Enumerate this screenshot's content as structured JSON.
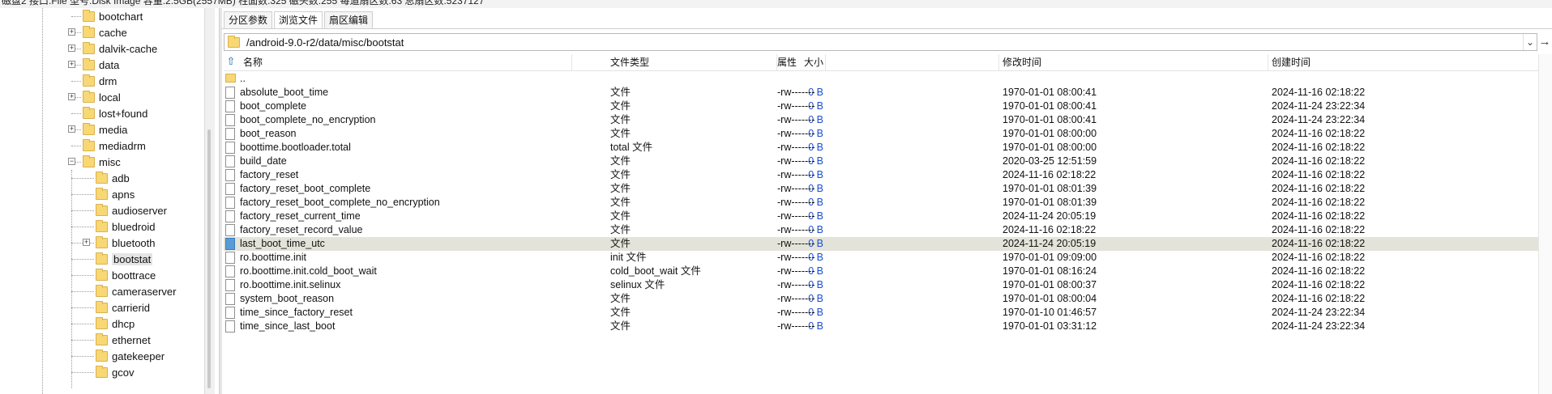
{
  "statusbar": {
    "text": "磁盘2 接口:File  型号:Disk Image  容量:2.5GB(2557MB)  柱面数:325  磁头数:255  每道扇区数:63  总扇区数:5237127"
  },
  "tree": {
    "items": [
      {
        "label": "bootchart",
        "expander": ""
      },
      {
        "label": "cache",
        "expander": "+"
      },
      {
        "label": "dalvik-cache",
        "expander": "+"
      },
      {
        "label": "data",
        "expander": "+"
      },
      {
        "label": "drm",
        "expander": ""
      },
      {
        "label": "local",
        "expander": "+"
      },
      {
        "label": "lost+found",
        "expander": ""
      },
      {
        "label": "media",
        "expander": "+"
      },
      {
        "label": "mediadrm",
        "expander": ""
      },
      {
        "label": "misc",
        "expander": "−"
      }
    ],
    "children": [
      {
        "label": "adb",
        "expander": ""
      },
      {
        "label": "apns",
        "expander": ""
      },
      {
        "label": "audioserver",
        "expander": ""
      },
      {
        "label": "bluedroid",
        "expander": ""
      },
      {
        "label": "bluetooth",
        "expander": "+"
      },
      {
        "label": "bootstat",
        "expander": "",
        "selected": true
      },
      {
        "label": "boottrace",
        "expander": ""
      },
      {
        "label": "cameraserver",
        "expander": ""
      },
      {
        "label": "carrierid",
        "expander": ""
      },
      {
        "label": "dhcp",
        "expander": ""
      },
      {
        "label": "ethernet",
        "expander": ""
      },
      {
        "label": "gatekeeper",
        "expander": ""
      },
      {
        "label": "gcov",
        "expander": ""
      }
    ]
  },
  "tabs": [
    {
      "label": "分区参数",
      "active": false
    },
    {
      "label": "浏览文件",
      "active": true
    },
    {
      "label": "扇区编辑",
      "active": false
    }
  ],
  "path": {
    "value": "/android-9.0-r2/data/misc/bootstat",
    "dropdown_icon": "chevron-down-icon",
    "go_icon": "arrow-right-icon",
    "go_label": "→"
  },
  "columns": {
    "up_label": "⇧",
    "name": "名称",
    "size": "大小",
    "type": "文件类型",
    "attr": "属性",
    "modified": "修改时间",
    "created": "创建时间"
  },
  "parent_row": "..",
  "files": [
    {
      "name": "absolute_boot_time",
      "size": "0 B",
      "type": "文件",
      "attr": "-rw-------",
      "modified": "1970-01-01 08:00:41",
      "created": "2024-11-16 02:18:22"
    },
    {
      "name": "boot_complete",
      "size": "0 B",
      "type": "文件",
      "attr": "-rw-------",
      "modified": "1970-01-01 08:00:41",
      "created": "2024-11-24 23:22:34"
    },
    {
      "name": "boot_complete_no_encryption",
      "size": "0 B",
      "type": "文件",
      "attr": "-rw-------",
      "modified": "1970-01-01 08:00:41",
      "created": "2024-11-24 23:22:34"
    },
    {
      "name": "boot_reason",
      "size": "0 B",
      "type": "文件",
      "attr": "-rw-------",
      "modified": "1970-01-01 08:00:00",
      "created": "2024-11-16 02:18:22"
    },
    {
      "name": "boottime.bootloader.total",
      "size": "0 B",
      "type": "total 文件",
      "attr": "-rw-------",
      "modified": "1970-01-01 08:00:00",
      "created": "2024-11-16 02:18:22"
    },
    {
      "name": "build_date",
      "size": "0 B",
      "type": "文件",
      "attr": "-rw-------",
      "modified": "2020-03-25 12:51:59",
      "created": "2024-11-16 02:18:22"
    },
    {
      "name": "factory_reset",
      "size": "0 B",
      "type": "文件",
      "attr": "-rw-------",
      "modified": "2024-11-16 02:18:22",
      "created": "2024-11-16 02:18:22"
    },
    {
      "name": "factory_reset_boot_complete",
      "size": "0 B",
      "type": "文件",
      "attr": "-rw-------",
      "modified": "1970-01-01 08:01:39",
      "created": "2024-11-16 02:18:22"
    },
    {
      "name": "factory_reset_boot_complete_no_encryption",
      "size": "0 B",
      "type": "文件",
      "attr": "-rw-------",
      "modified": "1970-01-01 08:01:39",
      "created": "2024-11-16 02:18:22"
    },
    {
      "name": "factory_reset_current_time",
      "size": "0 B",
      "type": "文件",
      "attr": "-rw-------",
      "modified": "2024-11-24 20:05:19",
      "created": "2024-11-16 02:18:22"
    },
    {
      "name": "factory_reset_record_value",
      "size": "0 B",
      "type": "文件",
      "attr": "-rw-------",
      "modified": "2024-11-16 02:18:22",
      "created": "2024-11-16 02:18:22"
    },
    {
      "name": "last_boot_time_utc",
      "size": "0 B",
      "type": "文件",
      "attr": "-rw-------",
      "modified": "2024-11-24 20:05:19",
      "created": "2024-11-16 02:18:22",
      "selected": true
    },
    {
      "name": "ro.boottime.init",
      "size": "0 B",
      "type": "init 文件",
      "attr": "-rw-------",
      "modified": "1970-01-01 09:09:00",
      "created": "2024-11-16 02:18:22"
    },
    {
      "name": "ro.boottime.init.cold_boot_wait",
      "size": "0 B",
      "type": "cold_boot_wait 文件",
      "attr": "-rw-------",
      "modified": "1970-01-01 08:16:24",
      "created": "2024-11-16 02:18:22"
    },
    {
      "name": "ro.boottime.init.selinux",
      "size": "0 B",
      "type": "selinux 文件",
      "attr": "-rw-------",
      "modified": "1970-01-01 08:00:37",
      "created": "2024-11-16 02:18:22"
    },
    {
      "name": "system_boot_reason",
      "size": "0 B",
      "type": "文件",
      "attr": "-rw-------",
      "modified": "1970-01-01 08:00:04",
      "created": "2024-11-16 02:18:22"
    },
    {
      "name": "time_since_factory_reset",
      "size": "0 B",
      "type": "文件",
      "attr": "-rw-------",
      "modified": "1970-01-10 01:46:57",
      "created": "2024-11-24 23:22:34"
    },
    {
      "name": "time_since_last_boot",
      "size": "0 B",
      "type": "文件",
      "attr": "-rw-------",
      "modified": "1970-01-01 03:31:12",
      "created": "2024-11-24 23:22:34"
    }
  ]
}
